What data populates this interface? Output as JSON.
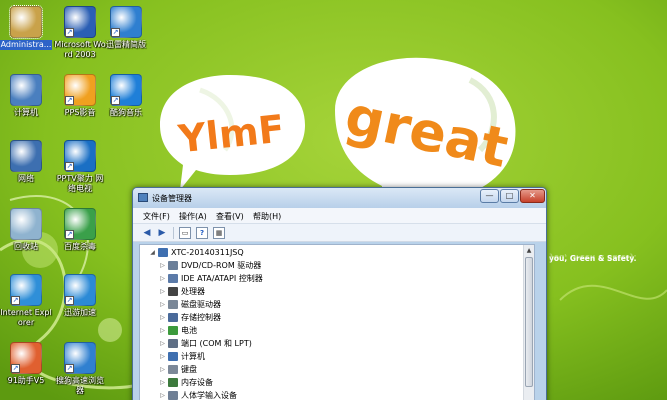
{
  "wallpaper": {
    "brand": "YlmF",
    "bubble_word": "great",
    "tagline": "you, Green & Safety."
  },
  "desktop_icons": [
    {
      "label": "Administra...",
      "icon": "user-folder-icon",
      "color": "#c9a24a",
      "arrow": false,
      "selected": true
    },
    {
      "label": "Microsoft Word 2003",
      "icon": "word-icon",
      "color": "#2b5fb4",
      "arrow": true
    },
    {
      "label": "迅雷精简版",
      "icon": "thunder-bird-icon",
      "color": "#2f7fd0",
      "arrow": true
    },
    {
      "label": "计算机",
      "icon": "computer-icon",
      "color": "#4a7fbf",
      "arrow": false
    },
    {
      "label": "PPS影音",
      "icon": "pps-icon",
      "color": "#f0a020",
      "arrow": true
    },
    {
      "label": "酷狗音乐",
      "icon": "kugou-icon",
      "color": "#1f7fd8",
      "arrow": true
    },
    {
      "label": "网络",
      "icon": "network-icon",
      "color": "#3d6fb0",
      "arrow": false
    },
    {
      "label": "PPTV聚力 网络电视",
      "icon": "pptv-icon",
      "color": "#1a6fc4",
      "arrow": true
    },
    {
      "label": "回收站",
      "icon": "recycle-bin-icon",
      "color": "#8fb3cf",
      "arrow": false
    },
    {
      "label": "百度杀毒",
      "icon": "shield-icon",
      "color": "#3aa04a",
      "arrow": true
    },
    {
      "label": "Internet Explorer",
      "icon": "ie-icon",
      "color": "#2f8fd8",
      "arrow": true
    },
    {
      "label": "迅游加速",
      "icon": "game-accelerator-icon",
      "color": "#2c8ad6",
      "arrow": true
    },
    {
      "label": "91助手V5",
      "icon": "assistant-icon",
      "color": "#e06030",
      "arrow": true
    },
    {
      "label": "搜狗高速浏览器",
      "icon": "sogou-browser-icon",
      "color": "#3080d0",
      "arrow": true
    }
  ],
  "window": {
    "title": "设备管理器",
    "controls": {
      "minimize": "—",
      "maximize": "□",
      "close": "✕"
    },
    "menu": [
      "文件(F)",
      "操作(A)",
      "查看(V)",
      "帮助(H)"
    ],
    "toolbar": {
      "back": "◀",
      "forward": "▶",
      "props": "▭",
      "help": "?",
      "view": "▦"
    },
    "tree": {
      "root": "XTC-20140311JSQ",
      "items": [
        {
          "label": "DVD/CD-ROM 驱动器",
          "icon": "dvd-drive-icon",
          "color": "#6b7f99"
        },
        {
          "label": "IDE ATA/ATAPI 控制器",
          "icon": "ide-controller-icon",
          "color": "#5b7aa8"
        },
        {
          "label": "处理器",
          "icon": "processor-icon",
          "color": "#444444"
        },
        {
          "label": "磁盘驱动器",
          "icon": "disk-drive-icon",
          "color": "#7a8797"
        },
        {
          "label": "存储控制器",
          "icon": "storage-controller-icon",
          "color": "#4a6a9a"
        },
        {
          "label": "电池",
          "icon": "battery-icon",
          "color": "#3c9a3c"
        },
        {
          "label": "端口 (COM 和 LPT)",
          "icon": "port-icon",
          "color": "#5f6f86"
        },
        {
          "label": "计算机",
          "icon": "computer-icon",
          "color": "#3f6fb0"
        },
        {
          "label": "键盘",
          "icon": "keyboard-icon",
          "color": "#7c8898"
        },
        {
          "label": "内存设备",
          "icon": "memory-icon",
          "color": "#3d7a3d"
        },
        {
          "label": "人体学输入设备",
          "icon": "hid-icon",
          "color": "#6f7f95"
        }
      ]
    }
  }
}
